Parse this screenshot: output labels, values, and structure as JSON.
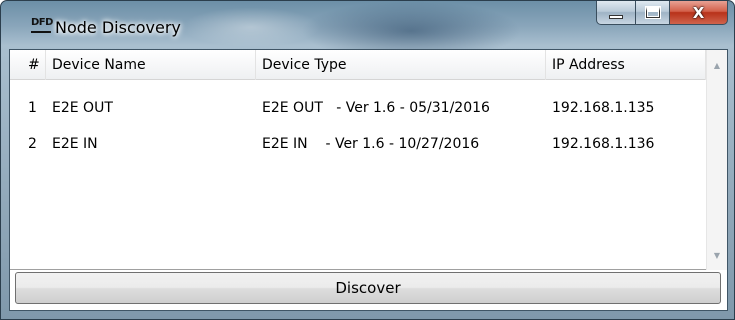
{
  "window": {
    "title": "Node Discovery",
    "icon_text": "DFD",
    "icon": "app-logo-icon",
    "caption_buttons": {
      "minimize_icon": "minimize-icon",
      "maximize_icon": "maximize-icon",
      "close_icon": "close-icon",
      "close_glyph": "X"
    }
  },
  "table": {
    "columns": [
      "#",
      "Device Name",
      "Device Type",
      "IP Address"
    ],
    "rows": [
      {
        "num": "1",
        "name": "E2E OUT",
        "type": "E2E OUT   - Ver 1.6 - 05/31/2016",
        "ip": "192.168.1.135"
      },
      {
        "num": "2",
        "name": "E2E IN",
        "type": "E2E IN    - Ver 1.6 - 10/27/2016",
        "ip": "192.168.1.136"
      }
    ]
  },
  "scrollbar": {
    "up_icon": "scroll-up-arrow-icon",
    "down_icon": "scroll-down-arrow-icon"
  },
  "actions": {
    "discover_label": "Discover"
  },
  "colors": {
    "close_button": "#c8452f",
    "title_glass": "#8aa6bb",
    "list_background": "#ffffff"
  }
}
